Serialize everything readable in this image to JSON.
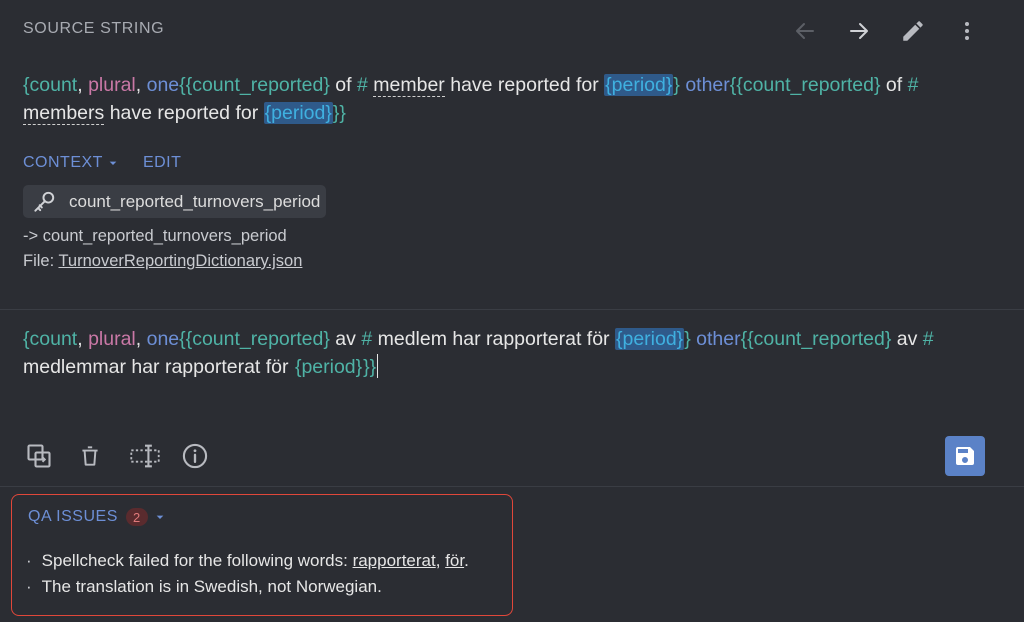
{
  "header": {
    "title": "SOURCE STRING"
  },
  "toolbar": {
    "prev_icon": "arrow-left-icon",
    "next_icon": "arrow-right-icon",
    "edit_icon": "pencil-icon",
    "menu_icon": "more-vertical-icon"
  },
  "source": {
    "tokens": [
      "{",
      "count",
      ", ",
      "plural",
      ", ",
      "one",
      "{",
      "{",
      "count_reported",
      "}",
      " of ",
      "#",
      " ",
      "member",
      " have reported for ",
      "{period}",
      "}",
      " ",
      "other",
      "{",
      "{",
      "count_reported",
      "}",
      " of ",
      "#",
      " ",
      "members",
      " have reported for ",
      "{period}",
      "}}"
    ]
  },
  "context": {
    "label": "CONTEXT",
    "edit_label": "EDIT",
    "key": "count_reported_turnovers_period",
    "line1": "-> count_reported_turnovers_period",
    "file_prefix": "File: ",
    "file_name": "TurnoverReportingDictionary.json"
  },
  "target": {
    "tokens": [
      "{",
      "count",
      ", ",
      "plural",
      ", ",
      "one",
      "{",
      "{",
      "count_reported",
      "}",
      " av ",
      "#",
      " medlem har rapporterat för ",
      "{period}",
      "}",
      " ",
      "other",
      "{",
      "{",
      "count_reported",
      "}",
      " av ",
      "#",
      " medlemmar har rapporterat för ",
      "{period}",
      "}}"
    ]
  },
  "actions": {
    "copy_icon": "copy-source-icon",
    "delete_icon": "trash-icon",
    "resize_icon": "text-field-icon",
    "info_icon": "info-icon",
    "save_icon": "save-icon"
  },
  "qa": {
    "label": "QA ISSUES",
    "count": "2",
    "item1_prefix": "Spellcheck failed for the following words: ",
    "item1_word1": "rapporterat",
    "item1_sep": ", ",
    "item1_word2": "för",
    "item1_end": ".",
    "item2": "The translation is in Swedish, not Norwegian."
  },
  "colors": {
    "background": "#2b2d33",
    "accent": "#6d8fd6",
    "variable": "#4fb3a6",
    "plural": "#c978a6",
    "highlight": "#2f5a8a",
    "error_border": "#e0473a",
    "save_button": "#5b82c7"
  }
}
